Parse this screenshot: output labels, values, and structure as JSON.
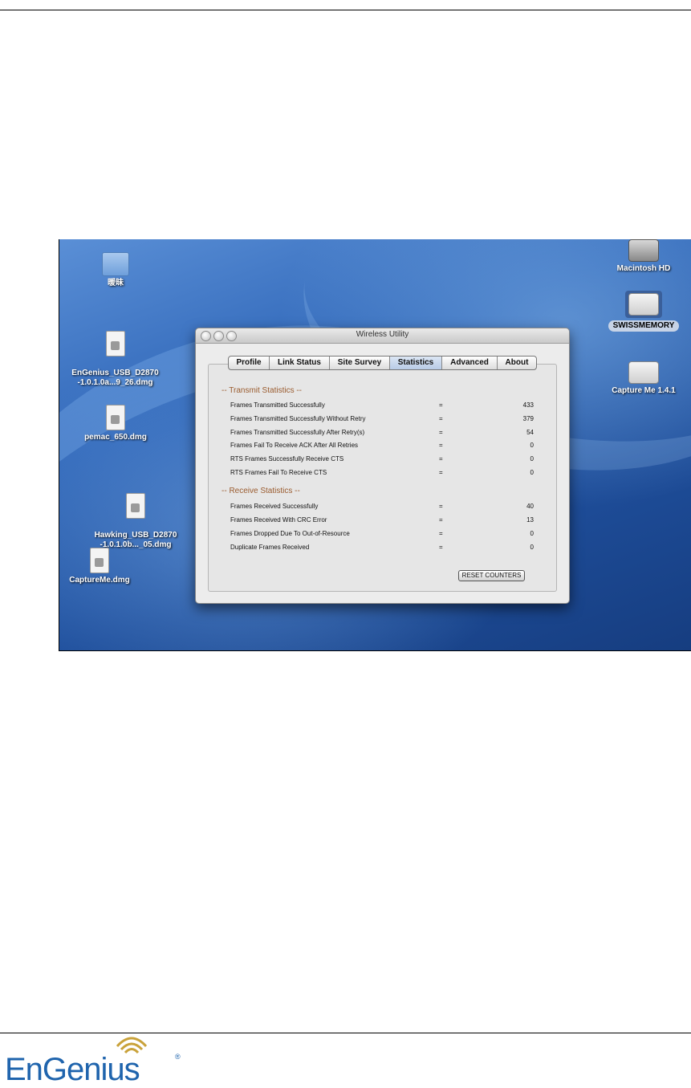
{
  "desktop": {
    "icons_left": [
      {
        "label": "暖昧",
        "kind": "folder"
      },
      {
        "label": "EnGenius_USB_D2870\n-1.0.1.0a...9_26.dmg",
        "kind": "dmg"
      },
      {
        "label": "pemac_650.dmg",
        "kind": "dmg"
      },
      {
        "label": "Hawking_USB_D2870\n-1.0.1.0b..._05.dmg",
        "kind": "dmg"
      },
      {
        "label": "CaptureMe.dmg",
        "kind": "dmg"
      }
    ],
    "icons_right": [
      {
        "label": "Macintosh HD",
        "kind": "harddisk"
      },
      {
        "label": "SWISSMEMORY",
        "kind": "drive-selected"
      },
      {
        "label": "Capture Me 1.4.1",
        "kind": "drive"
      }
    ]
  },
  "window": {
    "title": "Wireless Utility",
    "tabs": [
      "Profile",
      "Link Status",
      "Site Survey",
      "Statistics",
      "Advanced",
      "About"
    ],
    "active_tab": "Statistics",
    "transmit": {
      "title": "--  Transmit Statistics  --",
      "rows": [
        {
          "label": "Frames Transmitted Successfully",
          "eq": "=",
          "value": "433"
        },
        {
          "label": "Frames Transmitted Successfully Without Retry",
          "eq": "=",
          "value": "379"
        },
        {
          "label": "Frames Transmitted Successfully After Retry(s)",
          "eq": "=",
          "value": "54"
        },
        {
          "label": "Frames Fail To Receive ACK After All Retries",
          "eq": "=",
          "value": "0"
        },
        {
          "label": "RTS Frames Successfully Receive CTS",
          "eq": "=",
          "value": "0"
        },
        {
          "label": "RTS Frames Fail To Receive CTS",
          "eq": "=",
          "value": "0"
        }
      ]
    },
    "receive": {
      "title": "--  Receive Statistics  --",
      "rows": [
        {
          "label": "Frames Received Successfully",
          "eq": "=",
          "value": "40"
        },
        {
          "label": "Frames Received With CRC Error",
          "eq": "=",
          "value": "13"
        },
        {
          "label": "Frames Dropped Due To Out-of-Resource",
          "eq": "=",
          "value": "0"
        },
        {
          "label": "Duplicate Frames Received",
          "eq": "=",
          "value": "0"
        }
      ]
    },
    "reset_label": "RESET COUNTERS"
  },
  "footer": {
    "brand": "EnGenius",
    "registered": "®",
    "brand_color": "#1f64ad"
  }
}
